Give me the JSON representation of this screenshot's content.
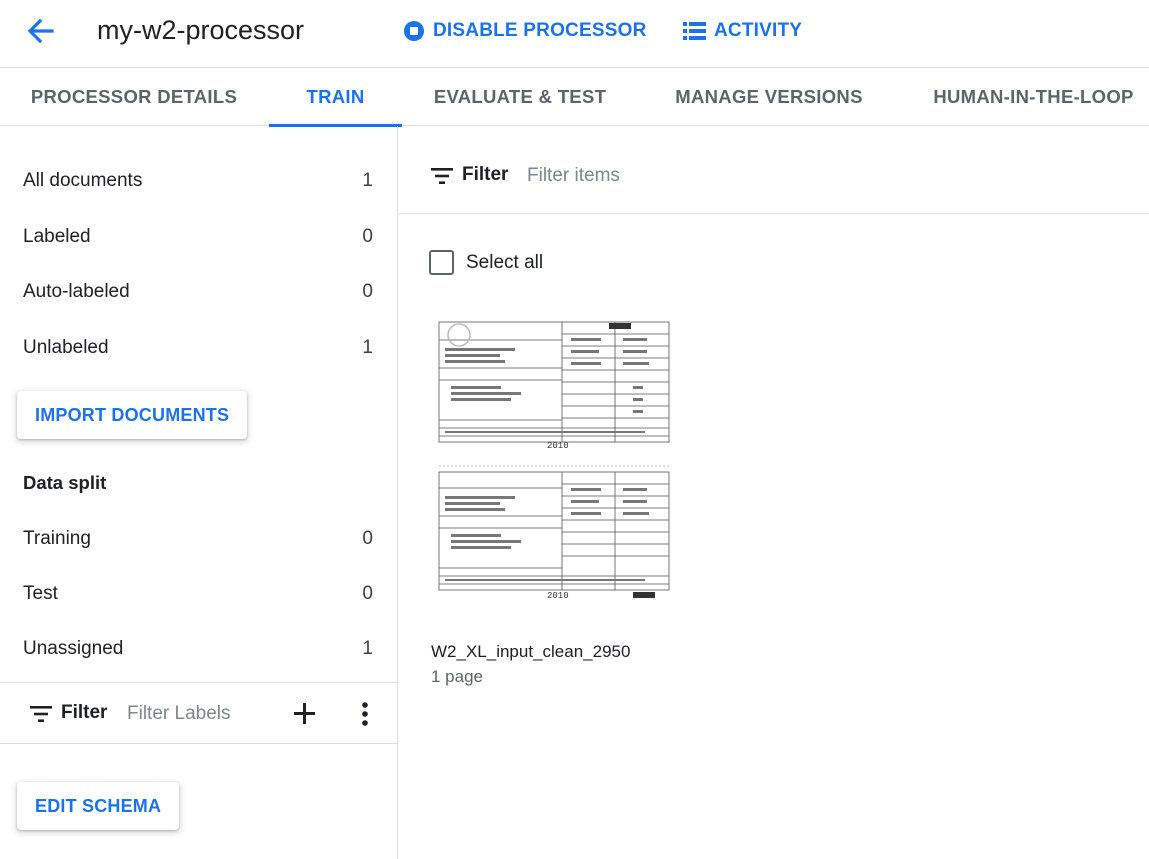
{
  "header": {
    "title": "my-w2-processor",
    "disable_label": "DISABLE PROCESSOR",
    "activity_label": "ACTIVITY",
    "accent_color": "#1a73e8"
  },
  "tabs": [
    {
      "label": "PROCESSOR DETAILS",
      "active": false
    },
    {
      "label": "TRAIN",
      "active": true
    },
    {
      "label": "EVALUATE & TEST",
      "active": false
    },
    {
      "label": "MANAGE VERSIONS",
      "active": false
    },
    {
      "label": "HUMAN-IN-THE-LOOP",
      "active": false
    }
  ],
  "sidebar": {
    "counts": [
      {
        "label": "All documents",
        "count": "1"
      },
      {
        "label": "Labeled",
        "count": "0"
      },
      {
        "label": "Auto-labeled",
        "count": "0"
      },
      {
        "label": "Unlabeled",
        "count": "1"
      }
    ],
    "import_label": "IMPORT DOCUMENTS",
    "data_split_heading": "Data split",
    "split": [
      {
        "label": "Training",
        "count": "0"
      },
      {
        "label": "Test",
        "count": "0"
      },
      {
        "label": "Unassigned",
        "count": "1"
      }
    ],
    "filter_label": "Filter",
    "filter_placeholder": "Filter Labels",
    "edit_schema_label": "EDIT SCHEMA"
  },
  "main": {
    "filter_label": "Filter",
    "filter_placeholder": "Filter items",
    "select_all_label": "Select all",
    "documents": [
      {
        "name": "W2_XL_input_clean_2950",
        "pages": "1 page"
      }
    ]
  },
  "icons": {
    "back": "arrow-back-icon",
    "disable": "stop-circle-icon",
    "activity": "list-icon",
    "filter": "filter-icon",
    "add": "plus-icon",
    "more": "more-vert-icon"
  }
}
